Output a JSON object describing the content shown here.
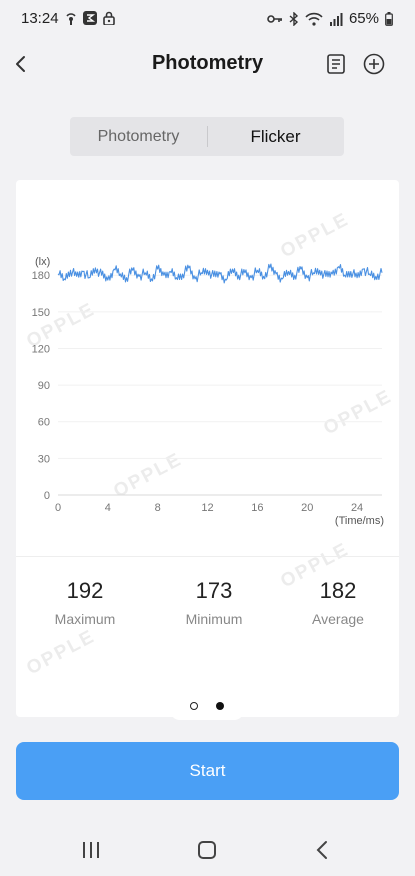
{
  "status_bar": {
    "time": "13:24",
    "battery": "65%",
    "left_icons": [
      "broadcast-icon",
      "app-badge-icon",
      "lock-icon"
    ],
    "right_icons": [
      "key-icon",
      "bluetooth-icon",
      "wifi-icon",
      "signal-icon",
      "battery-icon"
    ]
  },
  "header": {
    "title": "Photometry",
    "back_icon": "chevron-left-icon",
    "action_icons": [
      "document-icon",
      "add-circle-icon"
    ]
  },
  "segment": {
    "tabs": [
      {
        "label": "Photometry",
        "selected": false
      },
      {
        "label": "Flicker",
        "selected": true
      }
    ]
  },
  "watermark": "OPPLE",
  "chart_data": {
    "type": "line",
    "ylabel": "(lx)",
    "xlabel": "(Time/ms)",
    "xlim": [
      0,
      26
    ],
    "ylim": [
      0,
      190
    ],
    "x_ticks": [
      "0",
      "4",
      "8",
      "12",
      "16",
      "20",
      "24"
    ],
    "y_ticks": [
      "0",
      "30",
      "60",
      "90",
      "120",
      "150",
      "180"
    ],
    "series": [
      {
        "color": "#4a90e2",
        "description": "noisy signal around 180 lx across 0-26 ms",
        "x": [
          0,
          0.5,
          1,
          1.5,
          2,
          2.5,
          3,
          3.5,
          4,
          4.5,
          5,
          5.5,
          6,
          6.5,
          7,
          7.5,
          8,
          8.5,
          9,
          9.5,
          10,
          10.5,
          11,
          11.5,
          12,
          12.5,
          13,
          13.5,
          14,
          14.5,
          15,
          15.5,
          16,
          16.5,
          17,
          17.5,
          18,
          18.5,
          19,
          19.5,
          20,
          20.5,
          21,
          21.5,
          22,
          22.5,
          23,
          23.5,
          24,
          24.5,
          25,
          25.5,
          26
        ],
        "y": [
          181,
          177,
          184,
          179,
          183,
          178,
          186,
          180,
          176,
          185,
          181,
          178,
          184,
          179,
          182,
          177,
          185,
          180,
          183,
          178,
          181,
          186,
          177,
          182,
          184,
          179,
          181,
          176,
          185,
          180,
          182,
          178,
          184,
          179,
          186,
          181,
          177,
          183,
          180,
          185,
          178,
          182,
          184,
          179,
          181,
          187,
          180,
          183,
          178,
          185,
          181,
          179,
          182
        ]
      }
    ]
  },
  "stats": [
    {
      "value": "192",
      "label": "Maximum"
    },
    {
      "value": "173",
      "label": "Minimum"
    },
    {
      "value": "182",
      "label": "Average"
    }
  ],
  "pager": {
    "count": 2,
    "active": 1
  },
  "start_button": {
    "label": "Start"
  },
  "nav_bar": {
    "buttons": [
      "recent-apps-icon",
      "home-icon",
      "back-icon"
    ]
  }
}
